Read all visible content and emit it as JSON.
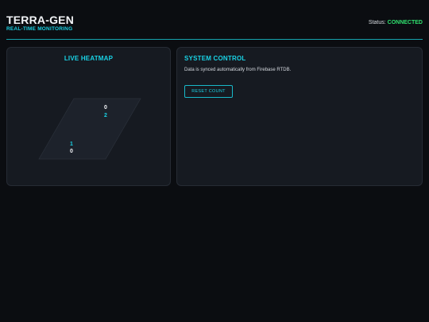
{
  "header": {
    "title": "TERRA-GEN",
    "subtitle": "REAL-TIME MONITORING",
    "status_label": "Status:",
    "status_value": "CONNECTED"
  },
  "colors": {
    "accent": "#19d3e6",
    "status_ok": "#2fe06e",
    "background": "#0b0d11",
    "card": "#161a21"
  },
  "heatmap": {
    "title": "LIVE HEATMAP",
    "cells": [
      {
        "position": "top-right",
        "top": "0",
        "bottom": "2"
      },
      {
        "position": "bottom-left",
        "top": "1",
        "bottom": "0"
      }
    ]
  },
  "control": {
    "title": "SYSTEM CONTROL",
    "sync_text": "Data is synced automatically from Firebase RTDB.",
    "reset_label": "RESET COUNT"
  }
}
